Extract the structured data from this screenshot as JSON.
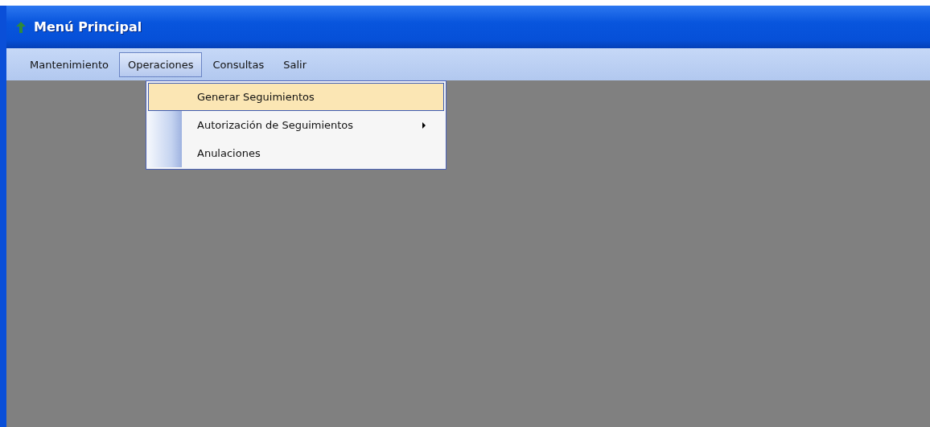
{
  "window": {
    "title": "Menú Principal"
  },
  "menu_bar": {
    "items": [
      {
        "label": "Mantenimiento",
        "selected": false
      },
      {
        "label": "Operaciones",
        "selected": true
      },
      {
        "label": "Consultas",
        "selected": false
      },
      {
        "label": "Salir",
        "selected": false
      }
    ]
  },
  "dropdown": {
    "items": [
      {
        "label": "Generar Seguimientos",
        "selected": true,
        "submenu": false
      },
      {
        "label": "Autorización de Seguimientos",
        "selected": false,
        "submenu": true
      },
      {
        "label": "Anulaciones",
        "selected": false,
        "submenu": false
      }
    ]
  }
}
